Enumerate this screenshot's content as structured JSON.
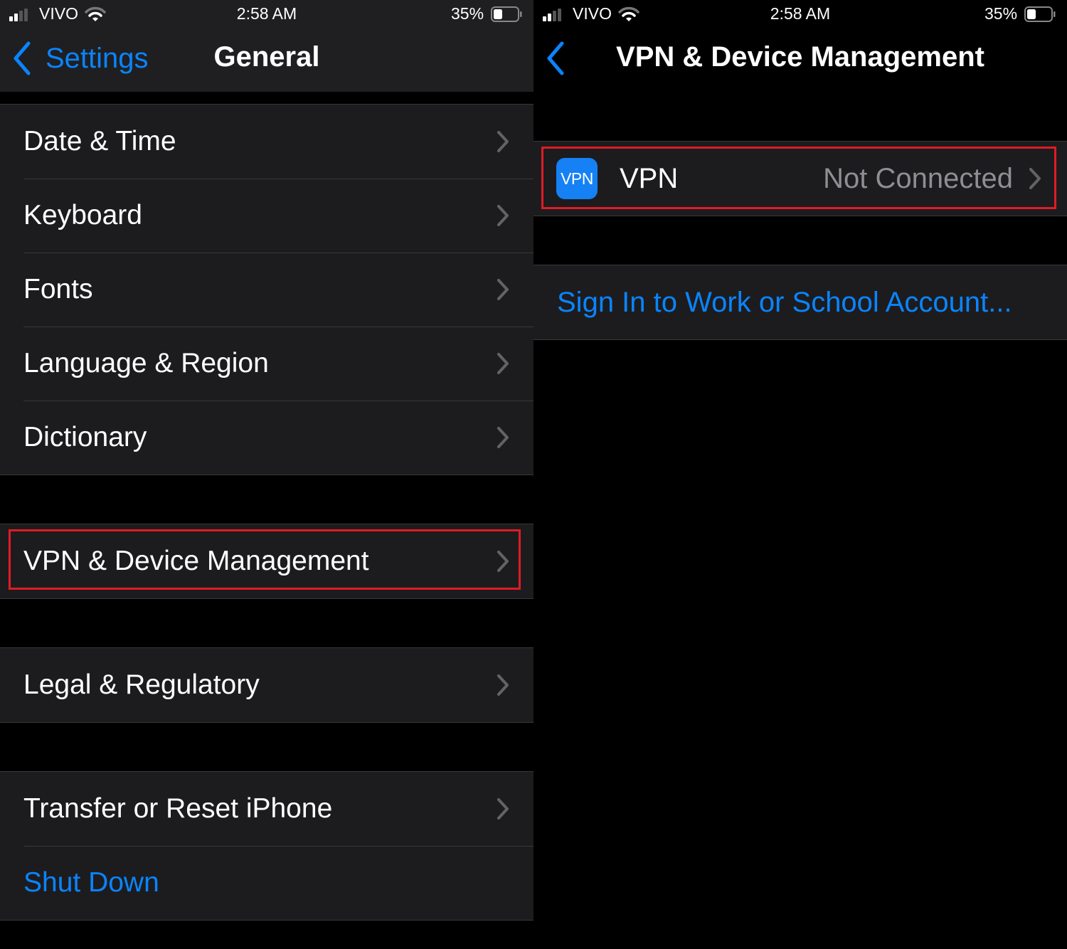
{
  "colors": {
    "accent": "#0a84ff",
    "highlight": "#e01b24",
    "background": "#000000",
    "cell_background": "#1c1c1e",
    "secondary_text": "#8e8e93",
    "vpn_icon": "#1581f4"
  },
  "left_screen": {
    "status_bar": {
      "carrier": "VIVO",
      "time": "2:58 AM",
      "battery_percent": "35%",
      "battery_level": 0.35,
      "signal_bars": 2,
      "signal_bars_total": 4
    },
    "nav": {
      "back_label": "Settings",
      "title": "General"
    },
    "groups": [
      {
        "items": [
          {
            "label": "Date & Time",
            "chevron": true
          },
          {
            "label": "Keyboard",
            "chevron": true
          },
          {
            "label": "Fonts",
            "chevron": true
          },
          {
            "label": "Language & Region",
            "chevron": true
          },
          {
            "label": "Dictionary",
            "chevron": true
          }
        ]
      },
      {
        "items": [
          {
            "label": "VPN & Device Management",
            "chevron": true,
            "highlighted": true
          }
        ]
      },
      {
        "items": [
          {
            "label": "Legal & Regulatory",
            "chevron": true
          }
        ]
      },
      {
        "items": [
          {
            "label": "Transfer or Reset iPhone",
            "chevron": true
          },
          {
            "label": "Shut Down",
            "chevron": false,
            "style": "link"
          }
        ]
      }
    ]
  },
  "right_screen": {
    "status_bar": {
      "carrier": "VIVO",
      "time": "2:58 AM",
      "battery_percent": "35%",
      "battery_level": 0.35,
      "signal_bars": 2,
      "signal_bars_total": 4
    },
    "nav": {
      "title": "VPN & Device Management"
    },
    "vpn_row": {
      "icon_text": "VPN",
      "label": "VPN",
      "status": "Not Connected",
      "highlighted": true
    },
    "sign_in_link": "Sign In to Work or School Account..."
  }
}
